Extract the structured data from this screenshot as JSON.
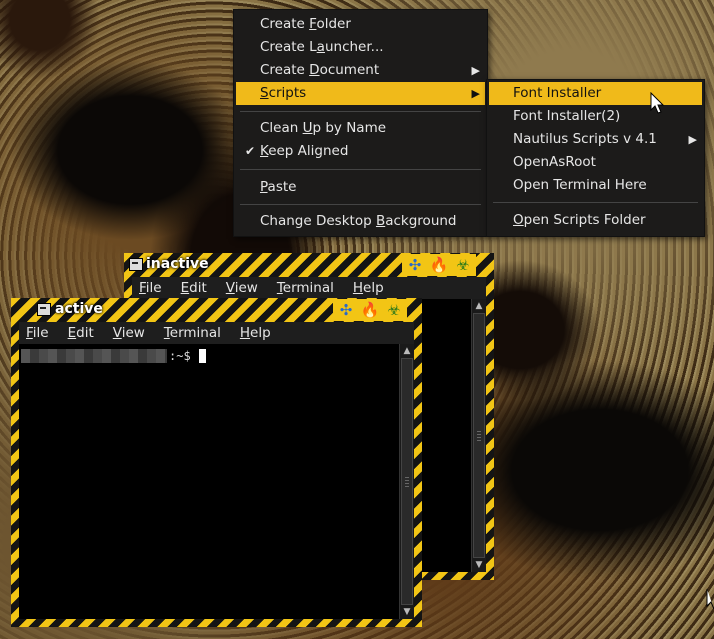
{
  "desktop_menu": {
    "items": [
      {
        "pre": "Create ",
        "ul": "F",
        "post": "older"
      },
      {
        "pre": "Create L",
        "ul": "a",
        "post": "uncher..."
      },
      {
        "pre": "Create ",
        "ul": "D",
        "post": "ocument"
      },
      {
        "pre": "",
        "ul": "S",
        "post": "cripts"
      },
      {
        "pre": "Clean ",
        "ul": "U",
        "post": "p by Name"
      },
      {
        "pre": "",
        "ul": "K",
        "post": "eep Aligned"
      },
      {
        "pre": "",
        "ul": "P",
        "post": "aste"
      },
      {
        "pre": "Change Desktop ",
        "ul": "B",
        "post": "ackground"
      }
    ],
    "checkmark": "✔"
  },
  "scripts_menu": {
    "items": [
      "Font Installer",
      "Font Installer(2)",
      "Nautilus Scripts v 4.1",
      "OpenAsRoot",
      "Open Terminal Here"
    ],
    "folder": {
      "ul": "O",
      "post": "pen Scripts Folder"
    }
  },
  "inactive_window": {
    "title": "inactive",
    "menus": [
      {
        "ul": "F",
        "post": "ile"
      },
      {
        "ul": "E",
        "post": "dit"
      },
      {
        "ul": "V",
        "post": "iew"
      },
      {
        "ul": "T",
        "post": "erminal"
      },
      {
        "ul": "H",
        "post": "elp"
      }
    ]
  },
  "active_window": {
    "title": "active",
    "menus": [
      {
        "ul": "F",
        "post": "ile"
      },
      {
        "ul": "E",
        "post": "dit"
      },
      {
        "ul": "V",
        "post": "iew"
      },
      {
        "ul": "T",
        "post": "erminal"
      },
      {
        "ul": "H",
        "post": "elp"
      }
    ],
    "prompt": ":~$"
  },
  "colors": {
    "accent": "#f0ba1a",
    "stripe_dark": "#141414",
    "menu_bg": "#1c1b1a"
  }
}
